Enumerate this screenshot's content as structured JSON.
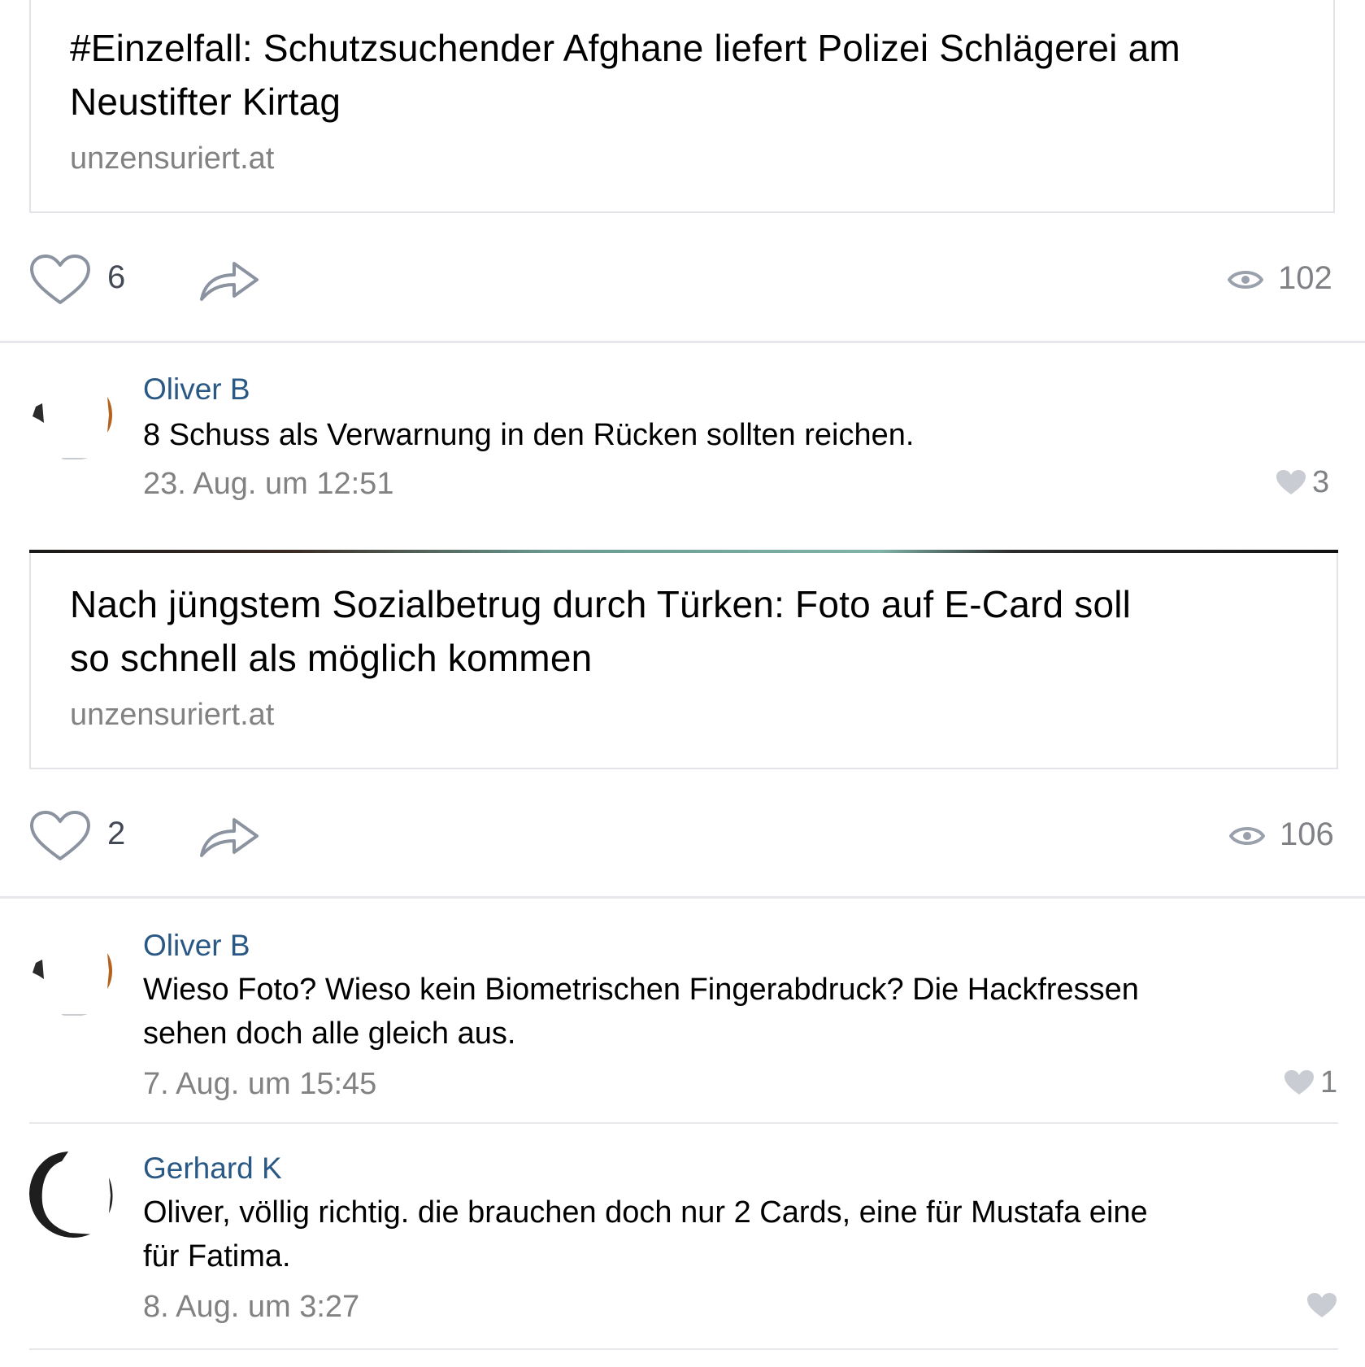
{
  "posts": [
    {
      "card": {
        "title_line1": "#Einzelfall: Schutzsuchender Afghane liefert Polizei Schlägerei am",
        "title_line2": "Neustifter Kirtag",
        "domain": "unzensuriert.at"
      },
      "actions": {
        "like_count": "6",
        "views": "102",
        "icons": [
          "heart-outline-icon",
          "share-arrow-icon",
          "eye-icon"
        ]
      },
      "comments": [
        {
          "author": "Oliver B",
          "text_lines": [
            "8 Schuss als Verwarnung in den Rücken sollten reichen."
          ],
          "timestamp": "23. Aug. um 12:51",
          "likes": "3"
        }
      ]
    },
    {
      "card": {
        "title_line1": "Nach jüngstem Sozialbetrug durch Türken: Foto auf E-Card soll",
        "title_line2": "so schnell als möglich kommen",
        "domain": "unzensuriert.at"
      },
      "actions": {
        "like_count": "2",
        "views": "106",
        "icons": [
          "heart-outline-icon",
          "share-arrow-icon",
          "eye-icon"
        ]
      },
      "comments": [
        {
          "author": "Oliver B",
          "text_lines": [
            "Wieso Foto? Wieso kein Biometrischen Fingerabdruck? Die Hackfressen",
            "sehen doch alle gleich aus."
          ],
          "timestamp": "7. Aug. um 15:45",
          "likes": "1"
        },
        {
          "author": "Gerhard K",
          "text_lines": [
            "Oliver, völlig richtig. die brauchen doch nur 2 Cards, eine für Mustafa eine",
            "für Fatima."
          ],
          "timestamp": "8. Aug. um 3:27",
          "likes": ""
        }
      ]
    }
  ],
  "colors": {
    "author_link": "#2a5885",
    "muted_text": "#828282",
    "icon_gray": "#828a99",
    "divider": "#e7e8ec"
  }
}
